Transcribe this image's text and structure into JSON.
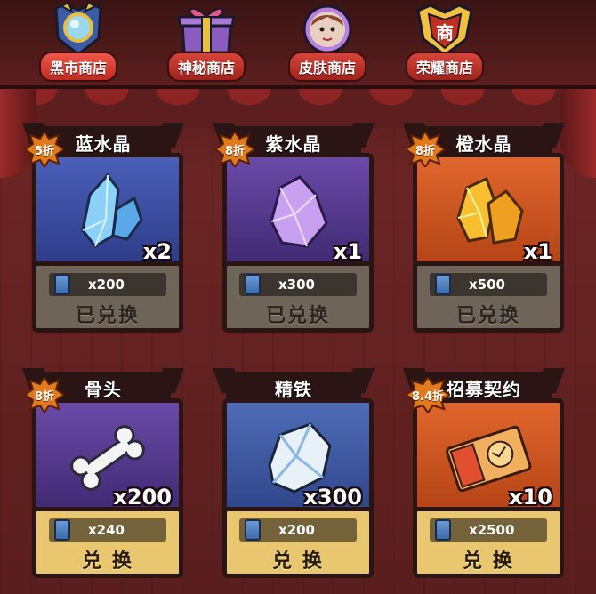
{
  "tabs": [
    {
      "label": "黑市商店",
      "icon": "magnifier-emblem-icon",
      "active": true
    },
    {
      "label": "神秘商店",
      "icon": "gift-box-icon",
      "active": false
    },
    {
      "label": "皮肤商店",
      "icon": "character-portrait-icon",
      "active": false
    },
    {
      "label": "荣耀商店",
      "icon": "honor-shield-icon",
      "active": false
    }
  ],
  "cards": [
    {
      "title": "蓝水晶",
      "discount": "5折",
      "quantity": "x2",
      "price": "x200",
      "action": "已兑换",
      "status": "redeemed",
      "icon": "blue-crystal-icon",
      "theme": "blue"
    },
    {
      "title": "紫水晶",
      "discount": "8折",
      "quantity": "x1",
      "price": "x300",
      "action": "已兑换",
      "status": "redeemed",
      "icon": "purple-crystal-icon",
      "theme": "purple"
    },
    {
      "title": "橙水晶",
      "discount": "8折",
      "quantity": "x1",
      "price": "x500",
      "action": "已兑换",
      "status": "redeemed",
      "icon": "orange-crystal-icon",
      "theme": "orange"
    },
    {
      "title": "骨头",
      "discount": "8折",
      "quantity": "x200",
      "price": "x240",
      "action": "兑 换",
      "status": "available",
      "icon": "bone-icon",
      "theme": "purple"
    },
    {
      "title": "精铁",
      "discount": "",
      "quantity": "x300",
      "price": "x200",
      "action": "兑 换",
      "status": "available",
      "icon": "iron-ore-icon",
      "theme": "steel"
    },
    {
      "title": "招募契约",
      "discount": "8.4折",
      "quantity": "x10",
      "price": "x2500",
      "action": "兑 换",
      "status": "available",
      "icon": "recruit-contract-icon",
      "theme": "orange"
    }
  ],
  "currency_icon": "ticket-icon",
  "colors": {
    "tab_red": "#c02a20",
    "redeemed_footer": "#6e6458",
    "available_footer": "#e8c770",
    "discount_badge": "#e07a1c"
  }
}
